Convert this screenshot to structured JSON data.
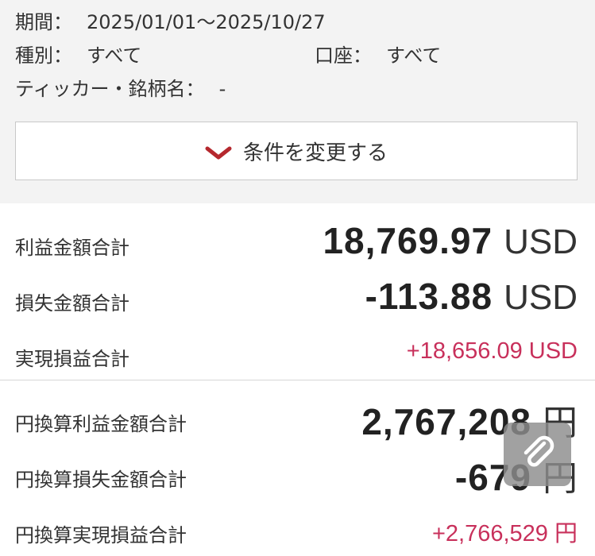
{
  "filter": {
    "period_label": "期間：",
    "period_value": "2025/01/01〜2025/10/27",
    "type_label": "種別：",
    "type_value": "すべて",
    "account_label": "口座：",
    "account_value": "すべて",
    "ticker_label": "ティッカー・銘柄名：",
    "ticker_value": "-",
    "change_button_label": "条件を変更する"
  },
  "summary": {
    "profit_total_label": "利益金額合計",
    "profit_total_value": "18,769.97",
    "profit_total_unit": "USD",
    "loss_total_label": "損失金額合計",
    "loss_total_value": "-113.88",
    "loss_total_unit": "USD",
    "realized_total_label": "実現損益合計",
    "realized_total_value": "+18,656.09 USD",
    "jpy_profit_total_label": "円換算利益金額合計",
    "jpy_profit_total_value": "2,767,208",
    "jpy_profit_total_unit": "円",
    "jpy_loss_total_label": "円換算損失金額合計",
    "jpy_loss_total_value": "-679",
    "jpy_loss_total_unit": "円",
    "jpy_realized_total_label": "円換算実現損益合計",
    "jpy_realized_total_value": "+2,766,529 円"
  },
  "colors": {
    "accent_red": "#c8305b",
    "chevron_red": "#b5282e",
    "panel_bg": "#f3f3f3"
  },
  "icons": {
    "chevron": "chevron-down-icon",
    "attach": "paperclip-icon"
  }
}
